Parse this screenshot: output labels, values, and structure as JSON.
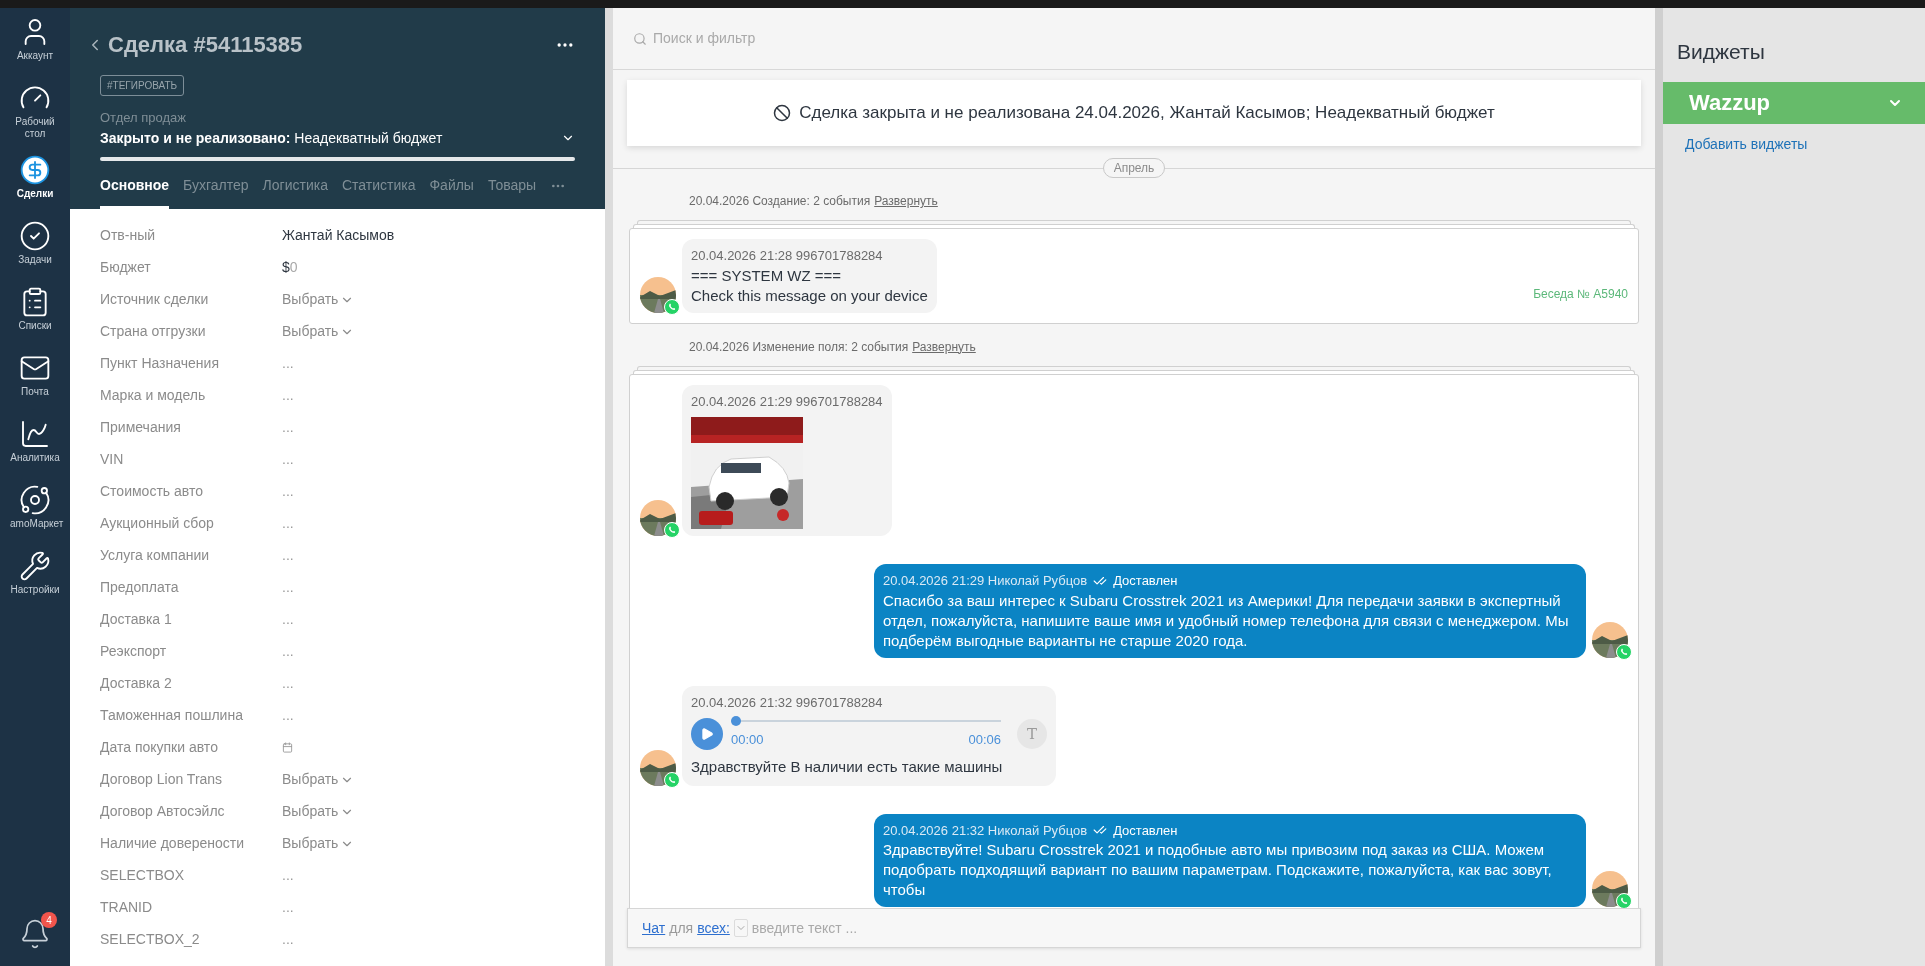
{
  "nav": {
    "items": [
      {
        "label": "Аккаунт",
        "selected": false
      },
      {
        "label": "Рабочий стол",
        "selected": false
      },
      {
        "label": "Сделки",
        "selected": true
      },
      {
        "label": "Задачи",
        "selected": false
      },
      {
        "label": "Списки",
        "selected": false
      },
      {
        "label": "Почта",
        "selected": false
      },
      {
        "label": "Аналитика",
        "selected": false
      },
      {
        "label": "amoМаркет",
        "selected": false
      },
      {
        "label": "Настройки",
        "selected": false
      }
    ],
    "notifications": "4"
  },
  "deal": {
    "title": "Сделка #54115385",
    "tag_button": "#ТЕГИРОВАТЬ",
    "pipeline": "Отдел продаж",
    "status": "**Закрыто и не реализовано:** Неадекватный бюджет",
    "tabs": [
      {
        "label": "Основное",
        "selected": true
      },
      {
        "label": "Бухгалтер",
        "selected": false
      },
      {
        "label": "Логистика",
        "selected": false
      },
      {
        "label": "Статистика",
        "selected": false
      },
      {
        "label": "Файлы",
        "selected": false
      },
      {
        "label": "Товары",
        "selected": false
      }
    ]
  },
  "fields": [
    {
      "label": "Отв-ный",
      "kind": "text",
      "value": "Жантай Касымов"
    },
    {
      "label": "Бюджет",
      "kind": "money",
      "currency": "$",
      "value": "0"
    },
    {
      "label": "Источник сделки",
      "kind": "select",
      "placeholder": "Выбрать"
    },
    {
      "label": "Страна отгрузки",
      "kind": "select",
      "placeholder": "Выбрать"
    },
    {
      "label": "Пункт Назначения",
      "kind": "empty",
      "placeholder": "..."
    },
    {
      "label": "Марка и модель",
      "kind": "empty",
      "placeholder": "..."
    },
    {
      "label": "Примечания",
      "kind": "empty",
      "placeholder": "..."
    },
    {
      "label": "VIN",
      "kind": "empty",
      "placeholder": "..."
    },
    {
      "label": "Стоимость авто",
      "kind": "empty",
      "placeholder": "..."
    },
    {
      "label": "Аукционный сбор",
      "kind": "empty",
      "placeholder": "..."
    },
    {
      "label": "Услуга компании",
      "kind": "empty",
      "placeholder": "..."
    },
    {
      "label": "Предоплата",
      "kind": "empty",
      "placeholder": "..."
    },
    {
      "label": "Доставка 1",
      "kind": "empty",
      "placeholder": "..."
    },
    {
      "label": "Реэкспорт",
      "kind": "empty",
      "placeholder": "..."
    },
    {
      "label": "Доставка 2",
      "kind": "empty",
      "placeholder": "..."
    },
    {
      "label": "Таможенная пошлина",
      "kind": "empty",
      "placeholder": "..."
    },
    {
      "label": "Дата покупки авто",
      "kind": "date"
    },
    {
      "label": "Договор Lion Trans",
      "kind": "select",
      "placeholder": "Выбрать"
    },
    {
      "label": "Договор Автосэйлс",
      "kind": "select",
      "placeholder": "Выбрать"
    },
    {
      "label": "Наличие доверености",
      "kind": "select",
      "placeholder": "Выбрать"
    },
    {
      "label": "SELECTBOX",
      "kind": "empty",
      "placeholder": "..."
    },
    {
      "label": "TRANID",
      "kind": "empty",
      "placeholder": "..."
    },
    {
      "label": "SELECTBOX_2",
      "kind": "empty",
      "placeholder": "..."
    }
  ],
  "feed": {
    "search_placeholder": "Поиск и фильтр",
    "banner": "Сделка закрыта и не реализована 24.04.2026, Жантай Касымов; Неадекватный бюджет",
    "month": "Апрель",
    "groups": [
      {
        "summary": "20.04.2026 Создание: 2 события",
        "expand_link": "Развернуть",
        "conversation": "Беседа № A5940",
        "messages": [
          {
            "kind": "incoming_text",
            "meta": "20.04.2026 21:28 996701788284",
            "lines": [
              "=== SYSTEM WZ ===",
              "Check this message on your device"
            ]
          }
        ]
      },
      {
        "summary": "20.04.2026 Изменение поля: 2 события",
        "expand_link": "Развернуть",
        "messages": [
          {
            "kind": "incoming_image",
            "meta": "20.04.2026 21:29 996701788284"
          },
          {
            "kind": "outgoing_text",
            "meta": "20.04.2026 21:29 Николай Рубцов",
            "status": "Доставлен",
            "lines": [
              "Спасибо за ваш интерес к Subaru Crosstrek 2021 из Америки! Для передачи заявки в экспертный отдел, пожалуйста, напишите ваше имя и удобный номер телефона для связи с менеджером. Мы подберём выгодные варианты не старше 2020 года."
            ]
          },
          {
            "kind": "incoming_audio",
            "meta": "20.04.2026 21:32 996701788284",
            "level": 0,
            "time_start": "00:00",
            "time_end": "00:06",
            "transcribe": "T",
            "lines": [
              "Здравствуйте В наличии есть такие машины"
            ]
          },
          {
            "kind": "outgoing_text",
            "meta": "20.04.2026 21:32 Николай Рубцов",
            "status": "Доставлен",
            "lines": [
              "Здравствуйте! Subaru Crosstrek 2021 и подобные авто мы привозим под заказ из США. Можем подобрать подходящий вариант по вашим параметрам. Подскажите, пожалуйста, как вас зовут, чтобы"
            ]
          }
        ]
      }
    ]
  },
  "composer": {
    "chat_link": "Чат",
    "for": "для",
    "all_link": "всех:",
    "placeholder": "введите текст ..."
  },
  "widgets": {
    "title": "Виджеты",
    "items": [
      {
        "name": "Wazzup",
        "color": "#66bb6a"
      }
    ],
    "add_link": "Добавить виджеты"
  }
}
